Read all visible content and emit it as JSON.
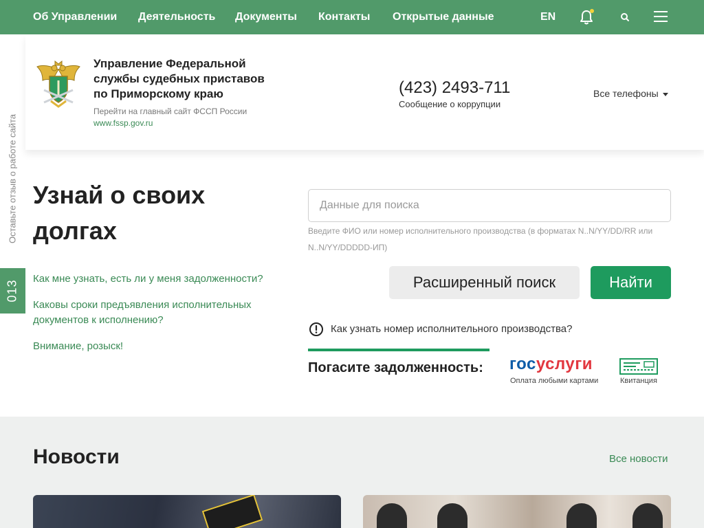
{
  "topnav": {
    "links": [
      "Об Управлении",
      "Деятельность",
      "Документы",
      "Контакты",
      "Открытые данные"
    ],
    "lang": "EN",
    "icons": [
      "bell-icon",
      "search-icon",
      "menu-icon"
    ],
    "colors": {
      "bar": "#519a6a",
      "notification_dot": "#f3d23a"
    }
  },
  "header": {
    "org_title": "Управление Федеральной службы судебных приставов по Приморскому краю",
    "goto_text": "Перейти на главный сайт ФССП России",
    "goto_url": "www.fssp.gov.ru",
    "phone": "(423) 2493-711",
    "phone_caption": "Сообщение о коррупции",
    "all_phones": "Все телефоны",
    "emblem_icon": "fssp-emblem-icon"
  },
  "side": {
    "feedback_label": "Оставьте отзыв о работе сайта",
    "counter": "013"
  },
  "debts": {
    "headline": "Узнай о своих долгах",
    "faq": [
      "Как мне узнать, есть ли у меня задолженности?",
      "Каковы сроки предъявления исполнительных документов к исполнению?",
      "Внимание, розыск!"
    ],
    "search_placeholder": "Данные для поиска",
    "search_value": "",
    "search_hint": "Введите ФИО или номер исполнительного производства (в форматах N..N/YY/DD/RR или N..N/YY/DDDDD-ИП)",
    "advanced_button": "Расширенный поиск",
    "find_button": "Найти",
    "help_link": "Как узнать номер исполнительного производства?",
    "pay_label": "Погасите задолженность:",
    "gosuslugi_part1": "гос",
    "gosuslugi_part2": "услуги",
    "gosuslugi_caption": "Оплата любыми картами",
    "receipt_caption": "Квитанция",
    "colors": {
      "accent": "#1e9b5e",
      "link": "#3a8a55",
      "gos_blue": "#0d5ca8",
      "gos_red": "#e2373f"
    }
  },
  "news": {
    "title": "Новости",
    "all_link": "Все новости"
  }
}
